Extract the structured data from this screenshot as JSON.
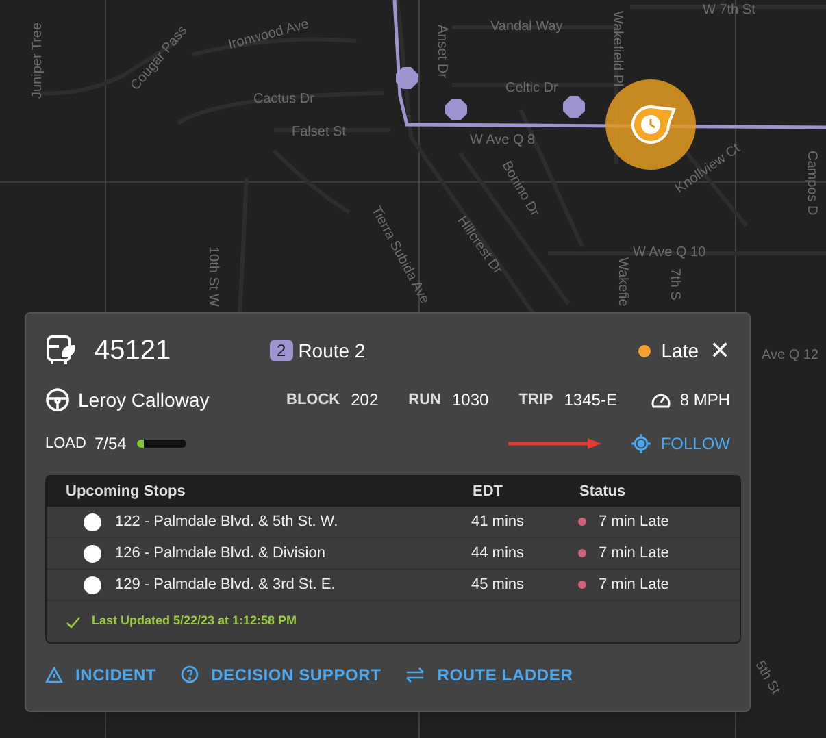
{
  "map": {
    "labels": [
      "Juniper Tree",
      "Cougar Pass",
      "Ironwood Ave",
      "Cactus Dr",
      "Falset St",
      "Vandal Way",
      "Anset Dr",
      "Celtic Dr",
      "W Ave Q 8",
      "Wakefield Pl",
      "W 7th St",
      "Tierra Subida Ave",
      "Bonino Dr",
      "Hillcrest Dr",
      "Knollview Ct",
      "Campos D",
      "W Ave Q 10",
      "10th St W",
      "Wakefie",
      "7th S",
      "Ave Q 12",
      "5th St"
    ]
  },
  "vehicle": {
    "id": "45121",
    "route_number": "2",
    "route": "Route 2",
    "status": "Late",
    "late": true,
    "close": "✕"
  },
  "driver": "Leroy Calloway",
  "fields": [
    {
      "label": "BLOCK",
      "value": "202"
    },
    {
      "label": "RUN",
      "value": "1030"
    },
    {
      "label": "TRIP",
      "value": "1345-E"
    }
  ],
  "speed": "8 MPH",
  "load": {
    "label": "LOAD",
    "value": "7/54",
    "level": 0.13
  },
  "follow": "FOLLOW",
  "stops": {
    "columns": [
      "Upcoming Stops",
      "EDT",
      "Status"
    ],
    "rows": [
      {
        "stop": "122 - Palmdale Blvd. & 5th St. W.",
        "edt": "41 mins",
        "status": "7 min Late",
        "color": "#d0607a"
      },
      {
        "stop": "126 - Palmdale Blvd. & Division",
        "edt": "44 mins",
        "status": "7 min Late",
        "color": "#d0607a"
      },
      {
        "stop": "129 - Palmdale Blvd. & 3rd St. E.",
        "edt": "45 mins",
        "status": "7 min Late",
        "color": "#d0607a"
      }
    ],
    "updated": "Last Updated 5/22/23 at 1:12:58 PM"
  },
  "actions": [
    {
      "kind": "incident",
      "label": "INCIDENT"
    },
    {
      "kind": "decision",
      "label": "DECISION SUPPORT"
    },
    {
      "kind": "ladder",
      "label": "ROUTE LADDER"
    }
  ]
}
